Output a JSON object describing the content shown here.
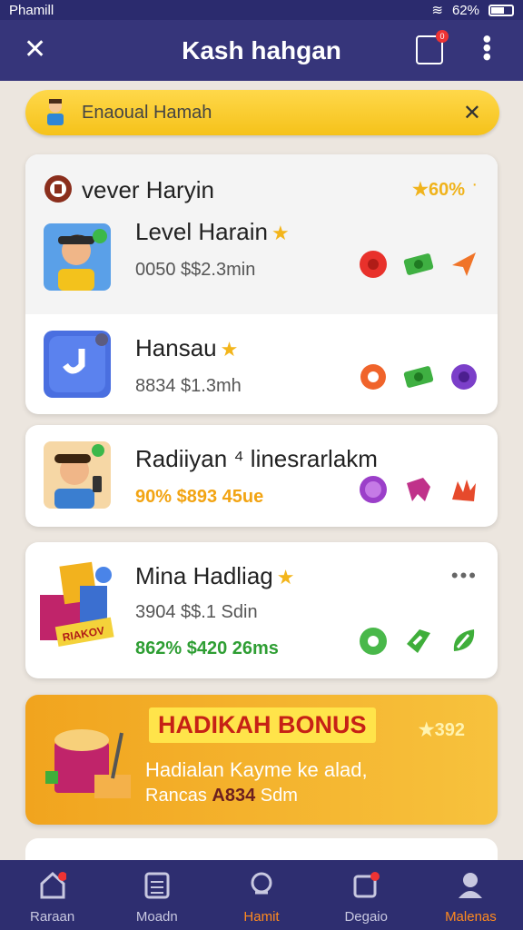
{
  "status": {
    "carrier": "Phamill",
    "battery": "62%"
  },
  "appbar": {
    "title": "Kash hahgan",
    "notif_count": "0"
  },
  "banner": {
    "label": "Enaoual Hamah"
  },
  "card1": {
    "header": {
      "title": "vever Haryin",
      "badge": "★60%",
      "dot": "·"
    },
    "rows": [
      {
        "name": "Level Harain",
        "sub": "0050 $$2.3min"
      },
      {
        "name": "Hansau",
        "sub": "8834 $1.3mh"
      }
    ]
  },
  "card2": {
    "name": "Radiiyan ⁴ linesrarlakm",
    "sub": "90% $893 45ue"
  },
  "card3": {
    "name": "Mina Hadliag",
    "sub1": "3904 $$.1 Sdin",
    "sub2": "862% $420 26ms",
    "box_label": "RIAKOV",
    "more": "•••"
  },
  "promo": {
    "title": "HADIKAH BONUS",
    "value": "★392",
    "line1": "Hadialan Kayme ke alad,",
    "line2_prefix": "Rancas",
    "line2_highlight": "A834",
    "line2_suffix": "Sdm"
  },
  "tabs": [
    {
      "label": "Raraan",
      "badge": "1"
    },
    {
      "label": "Moadn"
    },
    {
      "label": "Hamit"
    },
    {
      "label": "Degaio",
      "badge": "0"
    },
    {
      "label": "Malenas"
    }
  ]
}
